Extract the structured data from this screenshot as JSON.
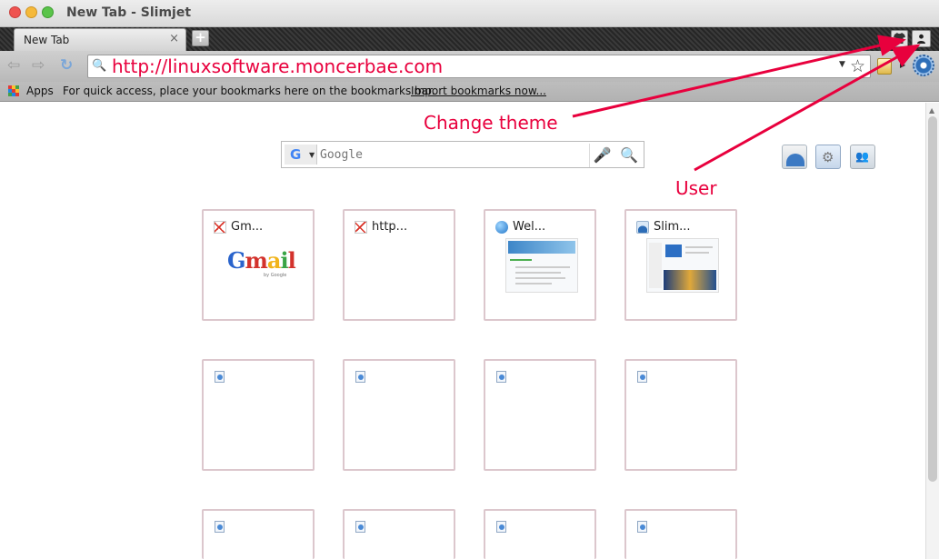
{
  "window": {
    "title": "New Tab - Slimjet"
  },
  "tabs": [
    {
      "label": "New Tab",
      "close": "×"
    }
  ],
  "tabstrip": {
    "new_tab": "+",
    "theme_icon": "shirt-icon",
    "user_icon": "user-icon"
  },
  "toolbar": {
    "back_icon": "⇦",
    "forward_icon": "⇨",
    "reload_icon": "↻",
    "url": "http://linuxsoftware.moncerbae.com",
    "search_icon": "🔍",
    "star_icon": "☆"
  },
  "bookmarks": {
    "apps_label": "Apps",
    "prompt": "For quick access, place your bookmarks here on the bookmarks bar.",
    "import_link": "Import bookmarks now..."
  },
  "search": {
    "placeholder": "Google",
    "engine_letter": "G"
  },
  "tiles": [
    {
      "title": "Gm...",
      "icon": "gmail-icon"
    },
    {
      "title": "http...",
      "icon": "gmail-icon"
    },
    {
      "title": "Wel...",
      "icon": "globe-icon"
    },
    {
      "title": "Slim...",
      "icon": "slimjet-icon"
    }
  ],
  "gmail_logo": {
    "g": "G",
    "m": "m",
    "a": "a",
    "i": "i",
    "l": "l",
    "sub": "by Google"
  },
  "annotations": {
    "change_theme": "Change theme",
    "user": "User"
  },
  "colors": {
    "annotation": "#e8003d",
    "tile_border": "#dcc7cd"
  }
}
